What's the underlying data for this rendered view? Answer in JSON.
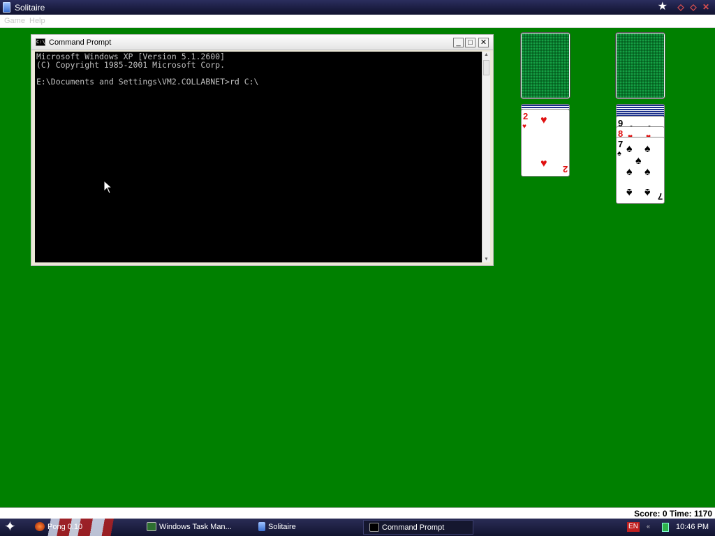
{
  "solitaire": {
    "title": "Solitaire",
    "menu": [
      "Game",
      "Help"
    ],
    "status": "Score: 0 Time: 1170",
    "table_color": "#008000",
    "cards": {
      "foundation_heart_rank": "2",
      "foundation_heart_suit": "♥",
      "tableau_top_rank_1": "9",
      "tableau_top_rank_2": "8",
      "tableau_spade_rank": "7",
      "tableau_spade_suit": "♠"
    }
  },
  "cmd": {
    "title": "Command Prompt",
    "lines": [
      "Microsoft Windows XP [Version 5.1.2600]",
      "(C) Copyright 1985-2001 Microsoft Corp.",
      "",
      "E:\\Documents and Settings\\VM2.COLLABNET>rd C:\\"
    ],
    "icon_text": "C:\\",
    "buttons": {
      "minimize": "_",
      "maximize": "□",
      "close": "✕"
    }
  },
  "taskbar": {
    "tasks": [
      {
        "label": "Pong 0.10",
        "icon": "pong-icon"
      },
      {
        "label": "Windows Task Man...",
        "icon": "task-manager-icon"
      },
      {
        "label": "Solitaire",
        "icon": "solitaire-icon"
      },
      {
        "label": "Command Prompt",
        "icon": "cmd-icon"
      }
    ],
    "tray": {
      "language": "EN",
      "clock": "10:46 PM"
    }
  }
}
